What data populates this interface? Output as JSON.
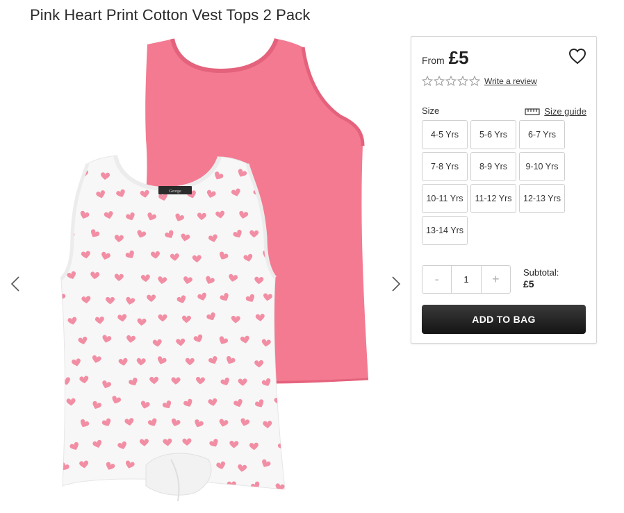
{
  "product": {
    "title": "Pink Heart Print Cotton Vest Tops 2 Pack",
    "price_prefix": "From",
    "price": "£5",
    "review_link": "Write a review",
    "rating_stars": 5,
    "rating_value": 0
  },
  "sizes": {
    "label": "Size",
    "guide_label": "Size guide",
    "options": [
      "4-5 Yrs",
      "5-6 Yrs",
      "6-7 Yrs",
      "7-8 Yrs",
      "8-9 Yrs",
      "9-10 Yrs",
      "10-11 Yrs",
      "11-12 Yrs",
      "12-13 Yrs",
      "13-14 Yrs"
    ]
  },
  "quantity": {
    "minus": "-",
    "value": "1",
    "plus": "+"
  },
  "subtotal": {
    "label": "Subtotal:",
    "value": "£5"
  },
  "add_to_bag": "ADD TO BAG",
  "image": {
    "label_text": "George",
    "colors": {
      "pink": "#f37a91",
      "pink_dark": "#e4627c",
      "white": "#f7f7f7",
      "heart": "#f28ea4"
    }
  },
  "icons": {
    "prev": "chevron-left-icon",
    "next": "chevron-right-icon",
    "wishlist": "heart-outline-icon",
    "ruler": "ruler-icon",
    "star": "star-outline-icon"
  }
}
